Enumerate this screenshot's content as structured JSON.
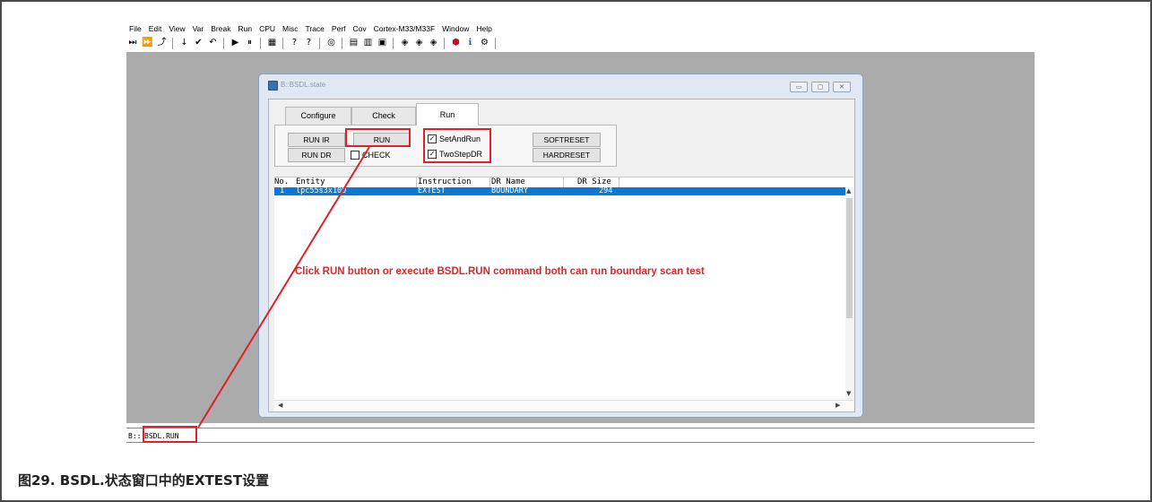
{
  "menu": [
    "File",
    "Edit",
    "View",
    "Var",
    "Break",
    "Run",
    "CPU",
    "Misc",
    "Trace",
    "Perf",
    "Cov",
    "Cortex-M33/M33F",
    "Window",
    "Help"
  ],
  "toolbar": {
    "icons": [
      "step-into-icon",
      "step-over-icon",
      "step-up-icon",
      "step-down-icon",
      "go-return-icon",
      "go-up-icon",
      "go-icon",
      "break-icon",
      "breakpoint-list-icon",
      "help-icon",
      "context-help-icon",
      "record-icon",
      "list-source-icon",
      "register-view-icon",
      "memory-dump-icon",
      "trace-icon",
      "trace-list-icon",
      "trace-chart-icon",
      "stop-icon",
      "info-icon",
      "settings-icon"
    ],
    "glyphs": [
      "⏭",
      "⏩",
      "⤴",
      "↓",
      "✔",
      "↶",
      "▶",
      "⏸",
      "▦",
      "?",
      "?",
      "◎",
      "▤",
      "▥",
      "▣",
      "◈",
      "◈",
      "◈",
      "⬢",
      "ℹ",
      "⚙"
    ]
  },
  "window": {
    "title": "B::BSDL.state",
    "controls": {
      "minimize": "▭",
      "maximize": "▢",
      "close": "✕"
    }
  },
  "tabs": [
    "Configure",
    "Check",
    "Run"
  ],
  "buttons": {
    "run_ir": "RUN IR",
    "run": "RUN",
    "run_dr": "RUN DR",
    "softreset": "SOFTRESET",
    "hardreset": "HARDRESET"
  },
  "checkboxes": {
    "check": {
      "label": "CHECK",
      "checked": false
    },
    "setandrun": {
      "label": "SetAndRun",
      "checked": true
    },
    "twostepdr": {
      "label": "TwoStepDR",
      "checked": true
    }
  },
  "table": {
    "headers": {
      "no": "No.",
      "entity": "Entity",
      "instruction": "Instruction",
      "dr_name": "DR Name",
      "dr_size": "DR Size"
    },
    "rows": [
      {
        "no": "1",
        "entity": "lpc55s3x100",
        "instruction": "EXTEST",
        "dr_name": "BOUNDARY",
        "dr_size": "294"
      }
    ]
  },
  "annotation": "Click RUN button or execute BSDL.RUN command both can run boundary scan test",
  "command": {
    "prompt": "B::",
    "text": "BSDL.RUN"
  },
  "caption": "图29. BSDL.状态窗口中的EXTEST设置",
  "colors": {
    "highlight": "#e0202a",
    "selection": "#0c78d6",
    "workspace": "#ababab"
  }
}
